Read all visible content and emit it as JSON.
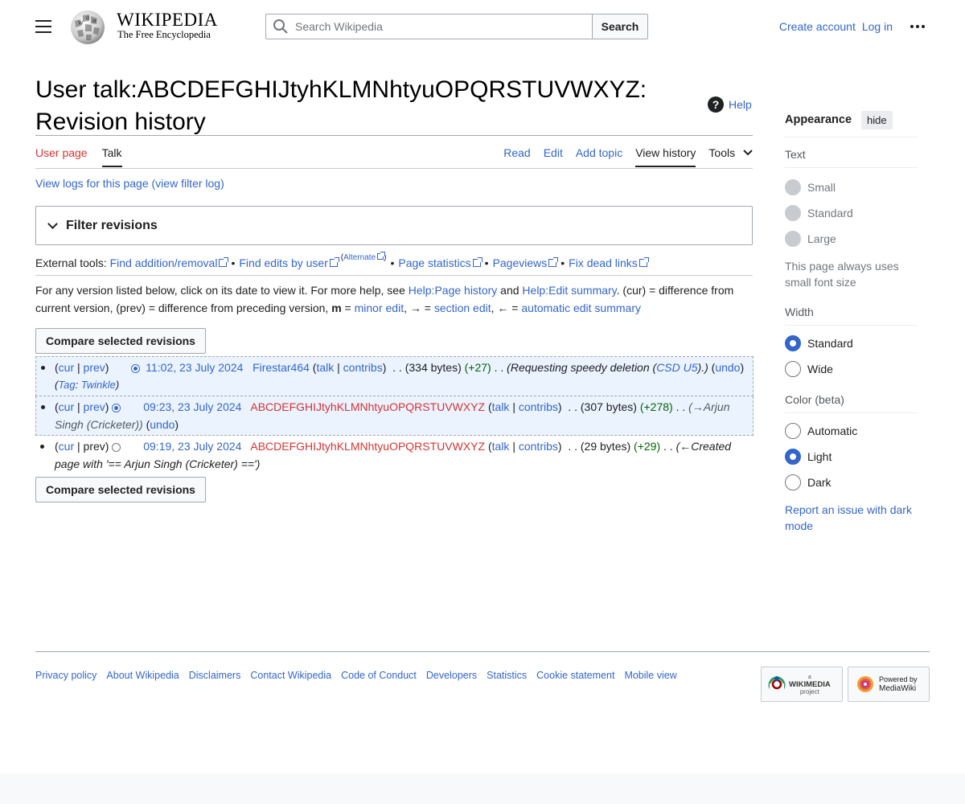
{
  "header": {
    "wordmark": "WIKIPEDIA",
    "tagline": "The Free Encyclopedia",
    "search_placeholder": "Search Wikipedia",
    "search_button": "Search",
    "create_account": "Create account",
    "log_in": "Log in"
  },
  "page": {
    "title": "User talk:ABCDEFGHIJtyhKLMNhtyuOPQRSTUVWXYZ: Revision history",
    "help": "Help"
  },
  "tabs": {
    "user_page": "User page",
    "talk": "Talk",
    "read": "Read",
    "edit": "Edit",
    "add_topic": "Add topic",
    "view_history": "View history",
    "tools": "Tools"
  },
  "view_logs": {
    "main": "View logs for this page",
    "open": "(",
    "filter": "view filter log",
    "close": ")"
  },
  "filter_label": "Filter revisions",
  "external_tools": {
    "label": "External tools:",
    "find_addition": "Find addition/removal",
    "find_edits": "Find edits by user",
    "alternate": "Alternate",
    "page_statistics": "Page statistics",
    "pageviews": "Pageviews",
    "fix_dead_links": "Fix dead links"
  },
  "info": {
    "t1": "For any version listed below, click on its date to view it. For more help, see ",
    "l1": "Help:Page history",
    "t2": " and ",
    "l2": "Help:Edit summary",
    "t3": ". (cur) = difference from current version, (prev) = difference from preceding version, ",
    "m": "m",
    "t4": " = ",
    "l3": "minor edit",
    "t5": ", → = ",
    "l4": "section edit",
    "t6": ", ← = ",
    "l5": "automatic edit summary"
  },
  "compare_button": "Compare selected revisions",
  "revisions": [
    {
      "cur": "cur",
      "prev": "prev",
      "date": "11:02, 23 July 2024",
      "user": "Firestar464",
      "talk": "talk",
      "contribs": "contribs",
      "bytes": "(334 bytes)",
      "diff": "(+27)",
      "summary_pre": "(Requesting speedy deletion (",
      "summary_link": "CSD U5",
      "summary_post": ").)",
      "undo": "undo",
      "tag_label": "Tag",
      "tag": "Twinkle"
    },
    {
      "cur": "cur",
      "prev": "prev",
      "date": "09:23, 23 July 2024",
      "user": "ABCDEFGHIJtyhKLMNhtyuOPQRSTUVWXYZ",
      "talk": "talk",
      "contribs": "contribs",
      "bytes": "(307 bytes)",
      "diff": "(+278)",
      "summary": "(→Arjun Singh (Cricketer))",
      "undo": "undo"
    },
    {
      "cur": "cur",
      "prev": "prev",
      "date": "09:19, 23 July 2024",
      "user": "ABCDEFGHIJtyhKLMNhtyuOPQRSTUVWXYZ",
      "talk": "talk",
      "contribs": "contribs",
      "bytes": "(29 bytes)",
      "diff": "(+29)",
      "summary": "(←Created page with '== Arjun Singh (Cricketer) ==')"
    }
  ],
  "sidebar": {
    "title": "Appearance",
    "hide": "hide",
    "text_section": "Text",
    "text_options": [
      "Small",
      "Standard",
      "Large"
    ],
    "text_note": "This page always uses small font size",
    "width_section": "Width",
    "width_options": [
      "Standard",
      "Wide"
    ],
    "color_section": "Color (beta)",
    "color_options": [
      "Automatic",
      "Light",
      "Dark"
    ],
    "report": "Report an issue with dark mode"
  },
  "footer": {
    "links": [
      "Privacy policy",
      "About Wikipedia",
      "Disclaimers",
      "Contact Wikipedia",
      "Code of Conduct",
      "Developers",
      "Statistics",
      "Cookie statement",
      "Mobile view"
    ],
    "wikimedia_a": "a",
    "wikimedia": "WIKIMEDIA",
    "wikimedia_project": "project",
    "powered_by": "Powered by",
    "mediawiki": "MediaWiki"
  }
}
